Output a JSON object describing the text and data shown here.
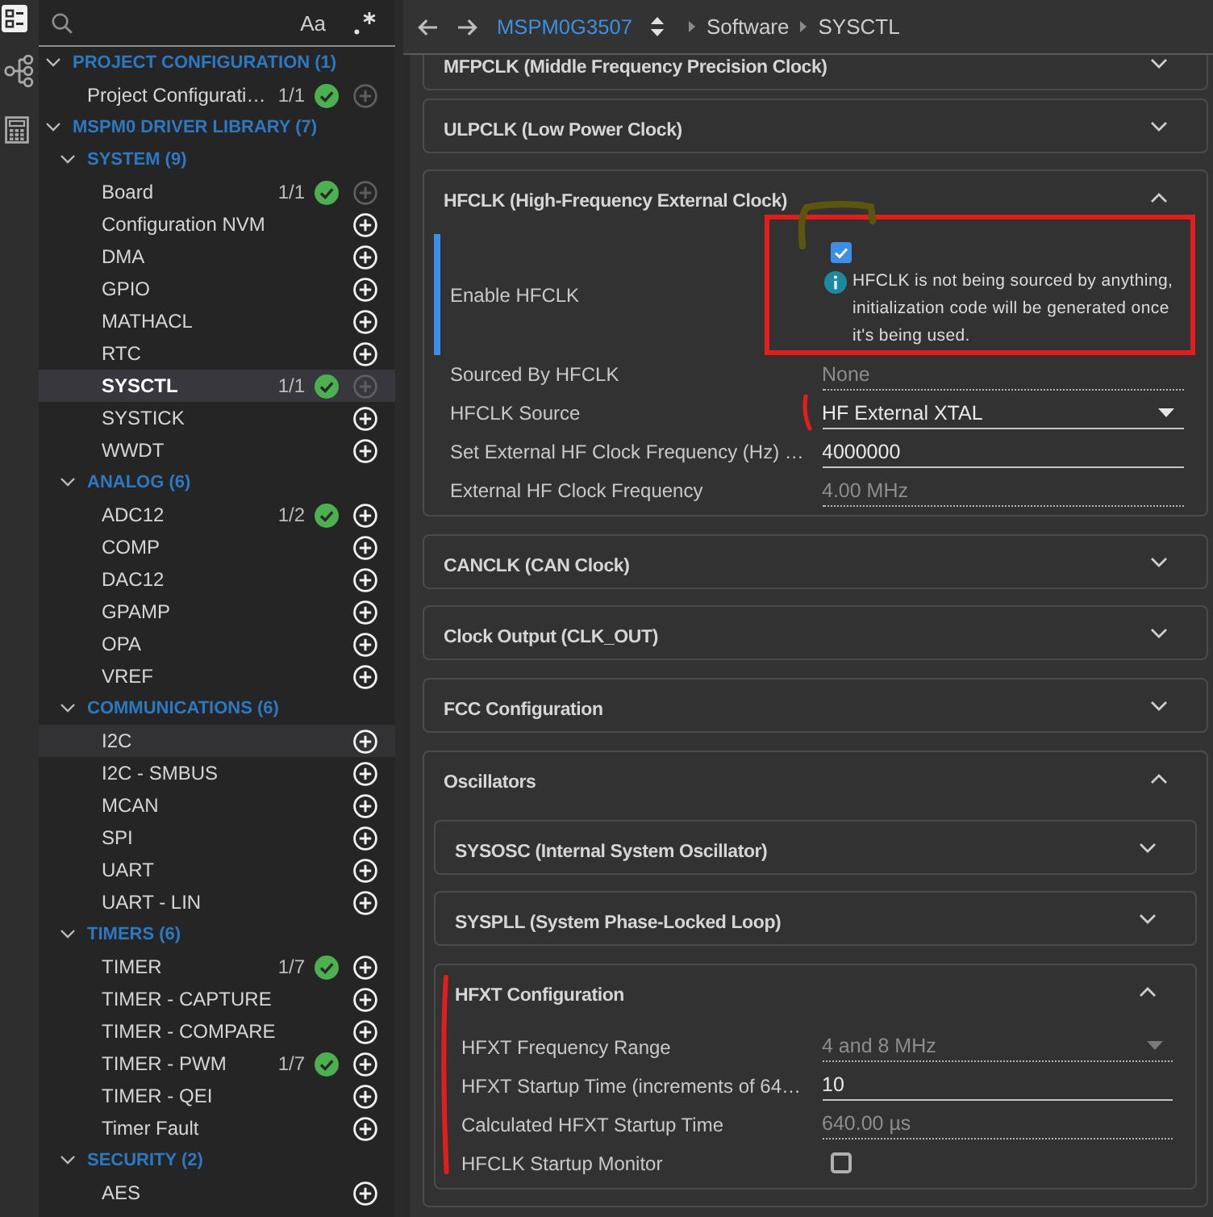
{
  "activity_bar": [
    {
      "selected": true
    },
    {
      "selected": false
    },
    {
      "selected": false
    }
  ],
  "sidebar": {
    "search": {
      "match_case": "Aa"
    },
    "tree": [
      {
        "kind": "category",
        "label": "PROJECT CONFIGURATION (1)",
        "expanded": true,
        "children": [
          {
            "kind": "module",
            "label": "Project Configurati…",
            "count": "1/1",
            "valid": true,
            "add_enabled": false,
            "selected": false,
            "hovered": false
          }
        ]
      },
      {
        "kind": "category",
        "label": "MSPM0 DRIVER LIBRARY (7)",
        "expanded": true,
        "children": [
          {
            "kind": "category",
            "label": "SYSTEM (9)",
            "expanded": true,
            "children": [
              {
                "kind": "module",
                "label": "Board",
                "count": "1/1",
                "valid": true,
                "add_enabled": false,
                "selected": false,
                "hovered": false
              },
              {
                "kind": "module",
                "label": "Configuration NVM",
                "valid": false,
                "add_enabled": true,
                "selected": false,
                "hovered": false
              },
              {
                "kind": "module",
                "label": "DMA",
                "valid": false,
                "add_enabled": true,
                "selected": false,
                "hovered": false
              },
              {
                "kind": "module",
                "label": "GPIO",
                "valid": false,
                "add_enabled": true,
                "selected": false,
                "hovered": false
              },
              {
                "kind": "module",
                "label": "MATHACL",
                "valid": false,
                "add_enabled": true,
                "selected": false,
                "hovered": false
              },
              {
                "kind": "module",
                "label": "RTC",
                "valid": false,
                "add_enabled": true,
                "selected": false,
                "hovered": false
              },
              {
                "kind": "module",
                "label": "SYSCTL",
                "count": "1/1",
                "valid": true,
                "add_enabled": false,
                "selected": true,
                "hovered": false
              },
              {
                "kind": "module",
                "label": "SYSTICK",
                "valid": false,
                "add_enabled": true,
                "selected": false,
                "hovered": false
              },
              {
                "kind": "module",
                "label": "WWDT",
                "valid": false,
                "add_enabled": true,
                "selected": false,
                "hovered": false
              }
            ]
          },
          {
            "kind": "category",
            "label": "ANALOG (6)",
            "expanded": true,
            "children": [
              {
                "kind": "module",
                "label": "ADC12",
                "count": "1/2",
                "valid": true,
                "add_enabled": true,
                "selected": false,
                "hovered": false
              },
              {
                "kind": "module",
                "label": "COMP",
                "valid": false,
                "add_enabled": true,
                "selected": false,
                "hovered": false
              },
              {
                "kind": "module",
                "label": "DAC12",
                "valid": false,
                "add_enabled": true,
                "selected": false,
                "hovered": false
              },
              {
                "kind": "module",
                "label": "GPAMP",
                "valid": false,
                "add_enabled": true,
                "selected": false,
                "hovered": false
              },
              {
                "kind": "module",
                "label": "OPA",
                "valid": false,
                "add_enabled": true,
                "selected": false,
                "hovered": false
              },
              {
                "kind": "module",
                "label": "VREF",
                "valid": false,
                "add_enabled": true,
                "selected": false,
                "hovered": false
              }
            ]
          },
          {
            "kind": "category",
            "label": "COMMUNICATIONS (6)",
            "expanded": true,
            "children": [
              {
                "kind": "module",
                "label": "I2C",
                "valid": false,
                "add_enabled": true,
                "selected": false,
                "hovered": true
              },
              {
                "kind": "module",
                "label": "I2C - SMBUS",
                "valid": false,
                "add_enabled": true,
                "selected": false,
                "hovered": false
              },
              {
                "kind": "module",
                "label": "MCAN",
                "valid": false,
                "add_enabled": true,
                "selected": false,
                "hovered": false
              },
              {
                "kind": "module",
                "label": "SPI",
                "valid": false,
                "add_enabled": true,
                "selected": false,
                "hovered": false
              },
              {
                "kind": "module",
                "label": "UART",
                "valid": false,
                "add_enabled": true,
                "selected": false,
                "hovered": false
              },
              {
                "kind": "module",
                "label": "UART - LIN",
                "valid": false,
                "add_enabled": true,
                "selected": false,
                "hovered": false
              }
            ]
          },
          {
            "kind": "category",
            "label": "TIMERS (6)",
            "expanded": true,
            "children": [
              {
                "kind": "module",
                "label": "TIMER",
                "count": "1/7",
                "valid": true,
                "add_enabled": true,
                "selected": false,
                "hovered": false
              },
              {
                "kind": "module",
                "label": "TIMER - CAPTURE",
                "valid": false,
                "add_enabled": true,
                "selected": false,
                "hovered": false
              },
              {
                "kind": "module",
                "label": "TIMER - COMPARE",
                "valid": false,
                "add_enabled": true,
                "selected": false,
                "hovered": false
              },
              {
                "kind": "module",
                "label": "TIMER - PWM",
                "count": "1/7",
                "valid": true,
                "add_enabled": true,
                "selected": false,
                "hovered": false
              },
              {
                "kind": "module",
                "label": "TIMER - QEI",
                "valid": false,
                "add_enabled": true,
                "selected": false,
                "hovered": false
              },
              {
                "kind": "module",
                "label": "Timer Fault",
                "valid": false,
                "add_enabled": true,
                "selected": false,
                "hovered": false
              }
            ]
          },
          {
            "kind": "category",
            "label": "SECURITY (2)",
            "expanded": true,
            "children": [
              {
                "kind": "module",
                "label": "AES",
                "valid": false,
                "add_enabled": true,
                "selected": false,
                "hovered": false
              }
            ]
          }
        ]
      }
    ]
  },
  "breadcrumb": {
    "device": "MSPM0G3507",
    "path": [
      "Software",
      "SYSCTL"
    ]
  },
  "sections": [
    {
      "title": "MFPCLK (Middle Frequency Precision Clock)",
      "expanded": false
    },
    {
      "title": "ULPCLK (Low Power Clock)",
      "expanded": false
    },
    {
      "title": "HFCLK (High-Frequency External Clock)",
      "expanded": true,
      "fields": [
        {
          "kind": "checkbox",
          "label": "Enable HFCLK",
          "checked": true,
          "focused": true,
          "message": "HFCLK is not being sourced by anything,\ninitialization code will be generated once\nit's being used.",
          "annotations": [
            {
              "kind": "box",
              "color": "#e21d1d"
            },
            {
              "kind": "scribble",
              "color": "#5a560f"
            }
          ]
        },
        {
          "kind": "readonly",
          "label": "Sourced By HFCLK",
          "value": "None",
          "focused": false
        },
        {
          "kind": "select",
          "label": "HFCLK Source",
          "value": "HF External XTAL",
          "disabled": false,
          "focused": false,
          "annotations": [
            {
              "kind": "stroke",
              "color": "#e21d1d"
            }
          ]
        },
        {
          "kind": "input",
          "label": "Set External HF Clock Frequency (Hz) …",
          "value": "4000000",
          "focused": false
        },
        {
          "kind": "readonly",
          "label": "External HF Clock Frequency",
          "value": "4.00 MHz",
          "focused": false
        }
      ]
    },
    {
      "title": "CANCLK (CAN Clock)",
      "expanded": false
    },
    {
      "title": "Clock Output (CLK_OUT)",
      "expanded": false
    },
    {
      "title": "FCC Configuration",
      "expanded": false
    },
    {
      "title": "Oscillators",
      "expanded": true,
      "sections": [
        {
          "title": "SYSOSC (Internal System Oscillator)",
          "expanded": false
        },
        {
          "title": "SYSPLL (System Phase-Locked Loop)",
          "expanded": false
        },
        {
          "title": "HFXT Configuration",
          "expanded": true,
          "annotations": [
            {
              "kind": "stroke",
              "color": "#e21d1d"
            }
          ],
          "fields": [
            {
              "kind": "select",
              "label": "HFXT Frequency Range",
              "value": "4 and 8 MHz",
              "disabled": true,
              "focused": false
            },
            {
              "kind": "input",
              "label": "HFXT Startup Time (increments of 64…",
              "value": "10",
              "focused": false
            },
            {
              "kind": "readonly",
              "label": "Calculated HFXT Startup Time",
              "value": "640.00 µs",
              "focused": false
            },
            {
              "kind": "checkbox",
              "label": "HFCLK Startup Monitor",
              "checked": false,
              "focused": false
            }
          ]
        }
      ]
    }
  ]
}
